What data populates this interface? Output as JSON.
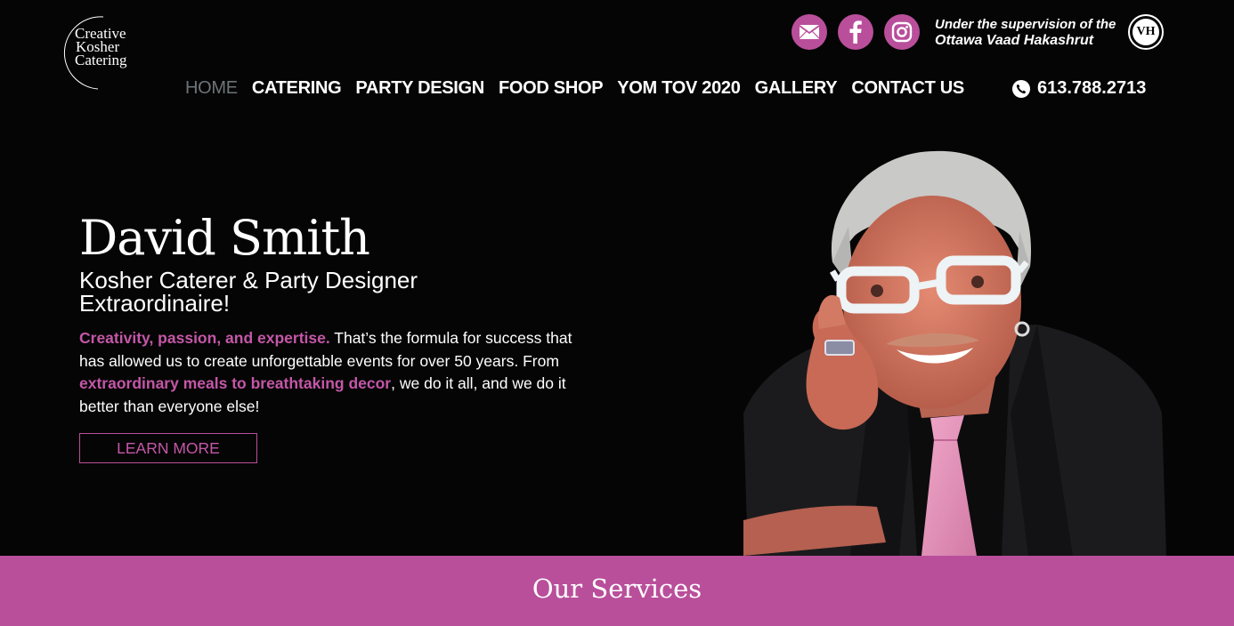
{
  "logo": {
    "line1": "Creative",
    "line2": "Kosher",
    "line3": "Catering"
  },
  "social": [
    {
      "icon": "email-icon"
    },
    {
      "icon": "facebook-icon"
    },
    {
      "icon": "instagram-icon"
    }
  ],
  "supervision": {
    "line1": "Under the supervision of the",
    "line2": "Ottawa Vaad Hakashrut",
    "badge": "VH"
  },
  "nav": {
    "items": [
      "HOME",
      "CATERING",
      "PARTY DESIGN",
      "FOOD SHOP",
      "YOM TOV 2020",
      "GALLERY",
      "CONTACT US"
    ],
    "phone": "613.788.2713"
  },
  "hero": {
    "name": "David Smith",
    "subtitle": "Kosher Caterer & Party Designer Extraordinaire!",
    "p_highlight1": "Creativity, passion, and expertise.",
    "p_text1": " That’s the formula for success that has allowed us to create unforgettable events for over 50 years. From ",
    "p_highlight2": "extraordinary meals to breathtaking decor",
    "p_text2": ", we do it all, and we do it better than everyone else!",
    "button": "LEARN MORE"
  },
  "services": {
    "title": "Our Services"
  },
  "colors": {
    "accent": "#b94f9b",
    "background": "#050505",
    "nav_active": "#6d7478"
  }
}
